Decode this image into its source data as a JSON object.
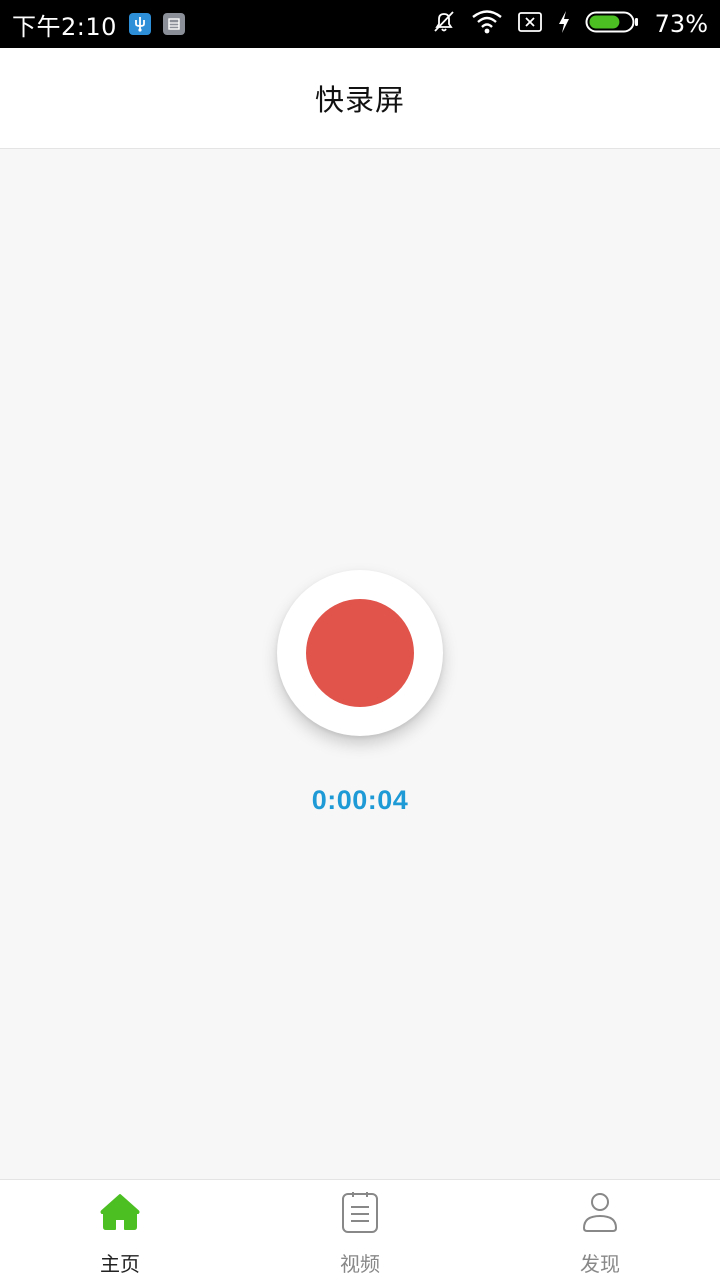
{
  "status_bar": {
    "time": "下午2:10",
    "battery_percent": "73%",
    "battery_level": 0.73,
    "icons": [
      "usb-icon",
      "sim-icon",
      "bell-off-icon",
      "wifi-icon",
      "no-signal-icon",
      "charging-icon",
      "battery-icon"
    ]
  },
  "app_bar": {
    "title": "快录屏"
  },
  "recorder": {
    "timer": "0:00:04",
    "button_icon": "record-icon"
  },
  "bottom_nav": {
    "items": [
      {
        "label": "主页",
        "icon": "home-icon",
        "active": true
      },
      {
        "label": "视频",
        "icon": "list-icon",
        "active": false
      },
      {
        "label": "发现",
        "icon": "user-icon",
        "active": false
      }
    ]
  },
  "colors": {
    "accent_green": "#4cbf23",
    "record_red": "#e0544b",
    "timer_blue": "#1e9ad6"
  }
}
